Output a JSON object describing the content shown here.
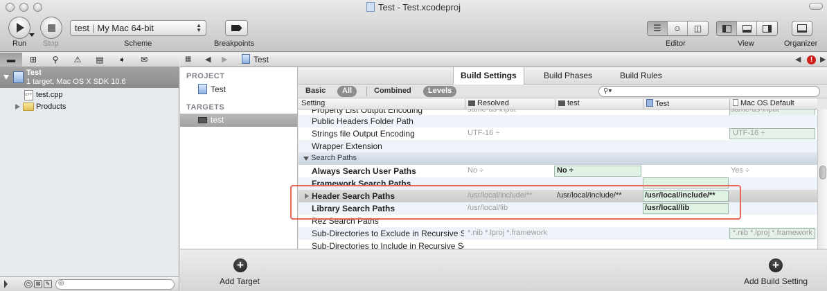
{
  "window": {
    "title": "Test - Test.xcodeproj"
  },
  "toolbar": {
    "run_label": "Run",
    "stop_label": "Stop",
    "scheme_target": "test",
    "scheme_destination": "My Mac 64-bit",
    "scheme_label": "Scheme",
    "breakpoints_label": "Breakpoints",
    "editor_label": "Editor",
    "view_label": "View",
    "organizer_label": "Organizer"
  },
  "navigator": {
    "project_name": "Test",
    "project_subtitle": "1 target, Mac OS X SDK 10.6",
    "file_name": "test.cpp",
    "file_icon_text": "c++",
    "folder_name": "Products"
  },
  "jumpbar": {
    "crumb": "Test"
  },
  "targets_panel": {
    "project_header": "PROJECT",
    "project_item": "Test",
    "targets_header": "TARGETS",
    "target_item": "test"
  },
  "editor": {
    "tabs": [
      "Build Settings",
      "Build Phases",
      "Build Rules"
    ],
    "filters": [
      "Basic",
      "All",
      "Combined",
      "Levels"
    ],
    "search_placeholder": ""
  },
  "grid": {
    "columns": [
      "Setting",
      "Resolved",
      "test",
      "Test",
      "Mac OS Default"
    ],
    "rows": [
      {
        "setting": "Property List Output Encoding",
        "resolved": "same-as-input",
        "mac": "same-as-input"
      },
      {
        "setting": "Public Headers Folder Path",
        "resolved": "",
        "mac": ""
      },
      {
        "setting": "Strings file Output Encoding",
        "resolved": "UTF-16 ÷",
        "mac": "UTF-16 ÷"
      },
      {
        "setting": "Wrapper Extension",
        "resolved": "",
        "mac": ""
      }
    ],
    "group_title": "Search Paths",
    "search_rows": [
      {
        "setting": "Always Search User Paths",
        "resolved": "No ÷",
        "target": "No ÷",
        "mac": "Yes ÷"
      },
      {
        "setting": "Framework Search Paths",
        "resolved": "",
        "target": "",
        "mac": ""
      },
      {
        "setting": "Header Search Paths",
        "resolved": "/usr/local/include/**",
        "target": "/usr/local/include/**",
        "project": "/usr/local/include/**",
        "mac": ""
      },
      {
        "setting": "Library Search Paths",
        "resolved": "/usr/local/lib",
        "target": "",
        "project": "/usr/local/lib",
        "mac": ""
      },
      {
        "setting": "Rez Search Paths",
        "resolved": "",
        "target": "",
        "mac": ""
      },
      {
        "setting": "Sub-Directories to Exclude in Recursive Searches",
        "resolved": "*.nib *.lproj *.framework",
        "target": "",
        "mac": "*.nib *.lproj *.framework"
      },
      {
        "setting": "Sub-Directories to Include in Recursive Searches",
        "resolved": "",
        "target": "",
        "mac": ""
      }
    ]
  },
  "bottom": {
    "add_target": "Add Target",
    "add_build_setting": "Add Build Setting"
  },
  "colors": {
    "highlight": "#e9665b",
    "selection": "#8c8c8c",
    "issue": "#d0201b"
  }
}
